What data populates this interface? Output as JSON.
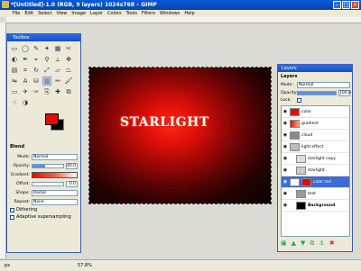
{
  "window": {
    "title": "*[Untitled]-1.0 (RGB, 9 layers) 1024x768 – GIMP"
  },
  "menu": [
    "File",
    "Edit",
    "Select",
    "View",
    "Image",
    "Layer",
    "Colors",
    "Tools",
    "Filters",
    "Windows",
    "Help"
  ],
  "canvas": {
    "text": "STARLIGHT"
  },
  "toolbox": {
    "title": "Toolbox",
    "tools": [
      "rect-select",
      "ellipse-select",
      "free-select",
      "fuzzy-select",
      "by-color-select",
      "scissors",
      "foreground-select",
      "paths",
      "color-picker",
      "zoom",
      "measure",
      "move",
      "align",
      "crop",
      "rotate",
      "scale",
      "shear",
      "perspective",
      "flip",
      "text",
      "bucket-fill",
      "blend",
      "pencil",
      "paintbrush",
      "eraser",
      "airbrush",
      "ink",
      "clone",
      "heal",
      "perspective-clone",
      "smudge",
      "dodge-burn"
    ],
    "options": {
      "header": "Blend",
      "mode_label": "Mode:",
      "mode_value": "Normal",
      "opacity_label": "Opacity:",
      "opacity_value": "40.0",
      "gradient_label": "Gradient:",
      "offset_label": "Offset:",
      "offset_value": "0.0",
      "shape_label": "Shape:",
      "shape_value": "Radial",
      "repeat_label": "Repeat:",
      "repeat_value": "None",
      "dithering": "Dithering",
      "adaptive": "Adaptive supersampling"
    }
  },
  "layers": {
    "title": "Layers",
    "tab": "Layers",
    "mode_label": "Mode:",
    "mode_value": "Normal",
    "opacity_label": "Opacity:",
    "opacity_value": "100.0",
    "lock_label": "Lock:",
    "items": [
      {
        "name": "color",
        "thumb": "#e01000"
      },
      {
        "name": "gradient",
        "thumb": "#f05030"
      },
      {
        "name": "cloud",
        "thumb": "#888888"
      },
      {
        "name": "light effect",
        "thumb": "#bbbbbb"
      },
      {
        "name": "starlight copy",
        "thumb": "#dddddd"
      },
      {
        "name": "starlight",
        "thumb": "#cccccc"
      },
      {
        "name": "color red",
        "thumb": "#e01000",
        "selected": true
      },
      {
        "name": "text",
        "thumb": "#999999"
      },
      {
        "name": "Background",
        "thumb": "#000000"
      }
    ]
  },
  "status": {
    "unit": "px",
    "zoom": "57.8%"
  }
}
